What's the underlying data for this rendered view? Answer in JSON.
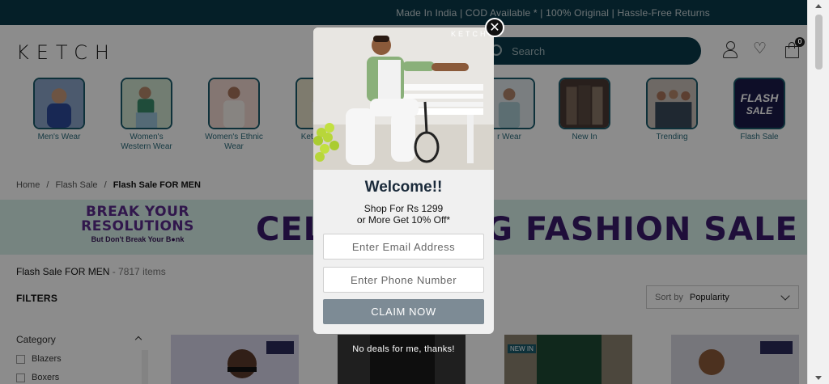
{
  "announcement": "Made In India | COD Available * | 100% Original | Hassle-Free Returns",
  "header": {
    "logo": "KETCH",
    "search_placeholder": "Search",
    "cart_count": "0",
    "icons": [
      "user-icon",
      "heart-icon",
      "bag-icon"
    ]
  },
  "categories": [
    {
      "label": "Men's Wear"
    },
    {
      "label": "Women's Western Wear"
    },
    {
      "label": "Women's Ethnic Wear"
    },
    {
      "label": "Ketch Rishi"
    },
    {
      "label": "r Wear"
    },
    {
      "label": "New In"
    },
    {
      "label": "Trending"
    },
    {
      "label": "Flash Sale",
      "thumb_text": "FLASH SALE"
    }
  ],
  "breadcrumb": {
    "home": "Home",
    "sep": "/",
    "level1": "Flash Sale",
    "current": "Flash Sale FOR MEN"
  },
  "banner": {
    "left_line1": "BREAK YOUR",
    "left_line2": "RESOLUTIONS",
    "left_line3": "But Don't Break Your B●nk",
    "big_text": "CELEBRATING FASHION SALE"
  },
  "listing": {
    "title": "Flash Sale FOR MEN",
    "count": "- 7817 items"
  },
  "filters_label": "FILTERS",
  "sort": {
    "label": "Sort by",
    "value": "Popularity"
  },
  "category_filter": {
    "title": "Category",
    "options": [
      "Blazers",
      "Boxers"
    ]
  },
  "product_badge": "NEW IN",
  "modal": {
    "brand": "KETCH",
    "close_symbol": "✕",
    "welcome": "Welcome!!",
    "offer_line1": "Shop For Rs 1299",
    "offer_line2": "or More Get 10% Off*",
    "email_placeholder": "Enter Email Address",
    "phone_placeholder": "Enter Phone Number",
    "claim_label": "CLAIM NOW",
    "decline_label": "No deals for me, thanks!"
  },
  "colors": {
    "topbar": "#0a3a4a",
    "accent_teal": "#1a5a6a",
    "banner_bg": "#d8f0ea",
    "banner_text": "#3a1a6a",
    "claim_button": "#7d8b95"
  }
}
